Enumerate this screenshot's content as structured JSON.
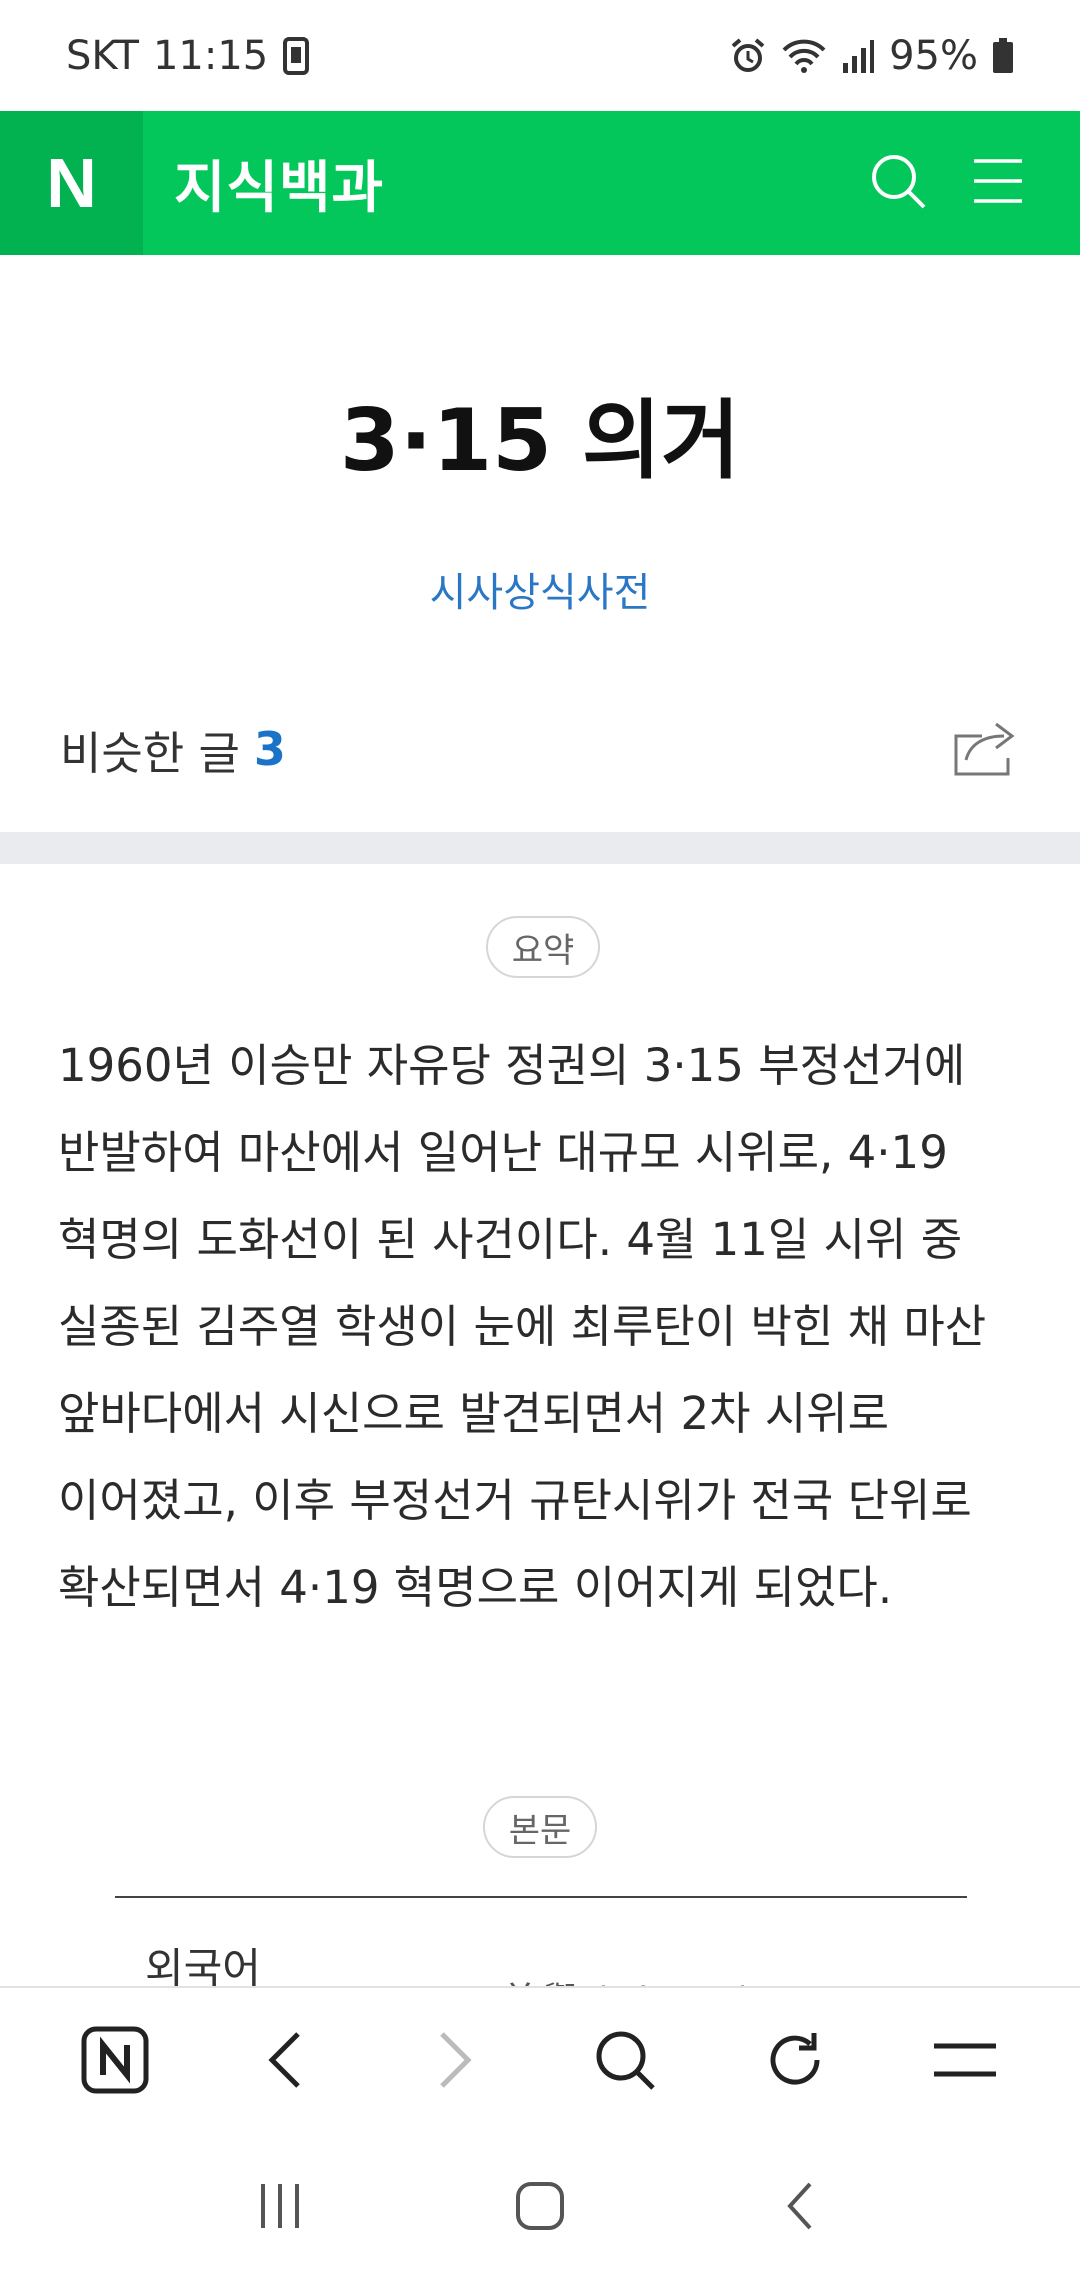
{
  "status_bar": {
    "carrier": "SKT",
    "time": "11:15",
    "battery": "95%",
    "icons": [
      "screen-icon",
      "alarm-icon",
      "wifi-icon",
      "signal-icon",
      "battery-icon"
    ]
  },
  "header": {
    "logo": "N",
    "service_name": "지식백과",
    "icons": [
      "search-icon",
      "menu-icon"
    ],
    "brand_color": "#03c75a"
  },
  "article": {
    "title": "3·15 의거",
    "source": "시사상식사전",
    "similar_label": "비슷한 글",
    "similar_count": "3",
    "summary_tag": "요약",
    "summary_text": "1960년 이승만 자유당 정권의 3·15 부정선거에 반발하여 마산에서 일어난 대규모 시위로, 4·19 혁명의 도화선이 된 사건이다. 4월 11일 시위 중 실종된 김주열 학생이 눈에 최루탄이 박힌 채 마산 앞바다에서 시신으로 발견되면서 2차 시위로 이어졌고, 이후 부정선거 규탄시위가 전국 단위로 확산되면서 4·19 혁명으로 이어지게 되었다.",
    "body_tag": "본문",
    "foreign_label": "외국어",
    "foreign_value": "義擧 (Ui-geo)"
  },
  "browser_toolbar": {
    "items": [
      "naver-home-icon",
      "back-icon",
      "forward-icon",
      "search-icon",
      "refresh-icon",
      "menu-icon"
    ]
  },
  "nav_bar": {
    "items": [
      "recent-apps-icon",
      "home-icon",
      "back-icon"
    ]
  }
}
